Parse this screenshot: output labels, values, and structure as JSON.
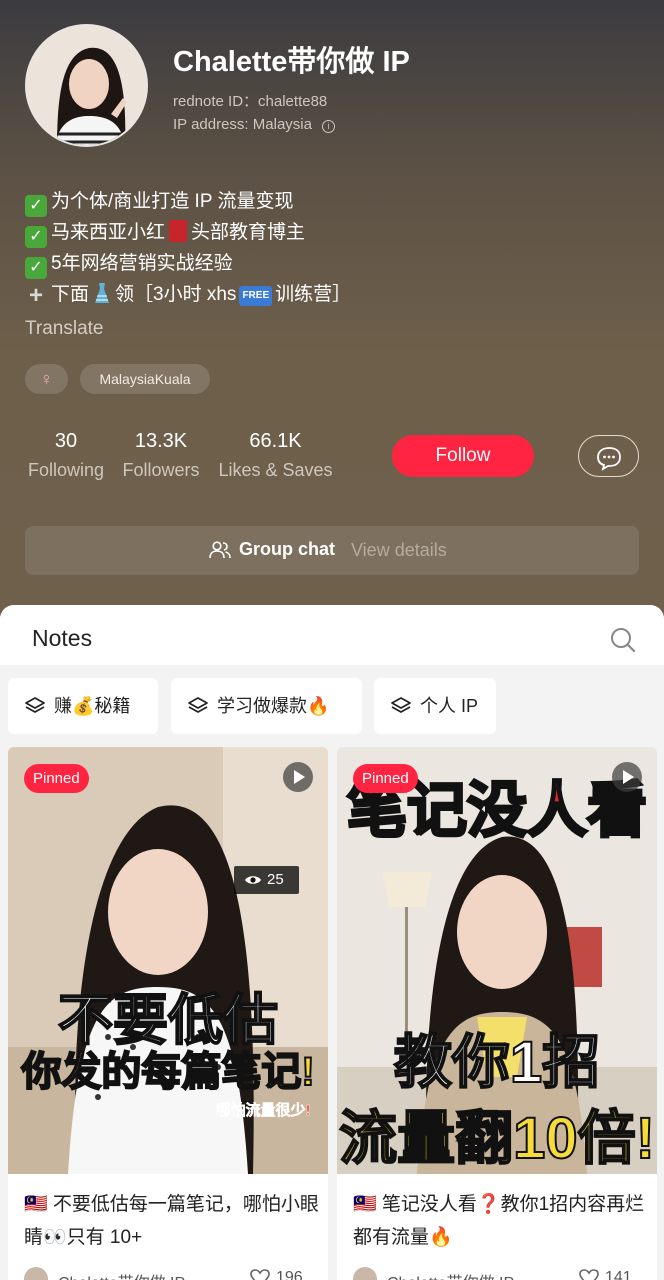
{
  "profile": {
    "name": "Chalette带你做 IP",
    "rednote_id": "rednote ID：chalette88",
    "ip_address": "IP address: Malaysia",
    "bio": [
      "为个体/商业打造 IP 流量变现",
      "马来西亚小红",
      "头部教育博主",
      "5年网络营销实战经验",
      "下面",
      "领［3小时 xhs",
      "FREE",
      "训练营］"
    ],
    "translate": "Translate",
    "tags": {
      "gender": "♀",
      "location": "MalaysiaKuala"
    },
    "stats": [
      {
        "value": "30",
        "label": "Following"
      },
      {
        "value": "13.3K",
        "label": "Followers"
      },
      {
        "value": "66.1K",
        "label": "Likes & Saves"
      }
    ],
    "follow_label": "Follow",
    "group_chat": {
      "label": "Group chat",
      "view": "View details"
    },
    "colors": {
      "accent": "#ff2442"
    }
  },
  "notes": {
    "title": "Notes",
    "collections": [
      "赚💰秘籍",
      "学习做爆款🔥",
      "个人 IP"
    ],
    "cards": [
      {
        "pinned": "Pinned",
        "views": "25",
        "overlay": [
          "不要低估",
          "你发的每篇笔记!",
          "哪怕流量很少!"
        ],
        "title": "🇲🇾 不要低估每一篇笔记，哪怕小眼睛👀只有 10+",
        "author": "Chalette带你做 IP",
        "likes": "196"
      },
      {
        "pinned": "Pinned",
        "overlay": [
          "笔记没人看",
          "教你1招",
          "流量翻10倍!"
        ],
        "title": "🇲🇾 笔记没人看❓教你1招内容再烂都有流量🔥",
        "author": "Chalette带你做 IP",
        "likes": "141"
      }
    ]
  }
}
